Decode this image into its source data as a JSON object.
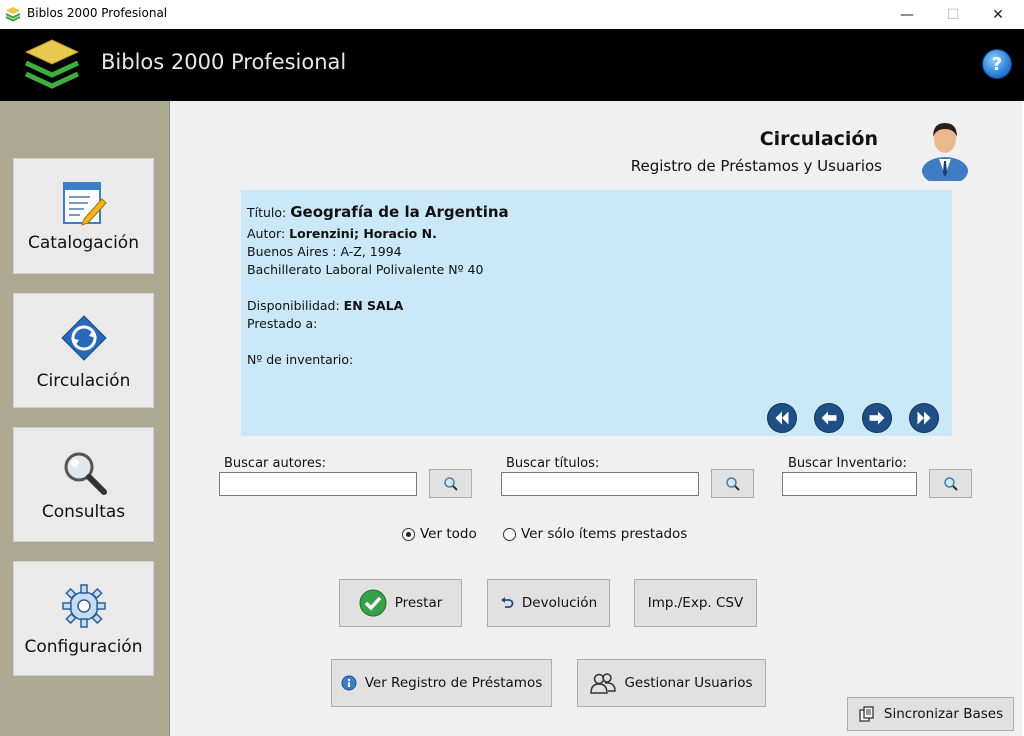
{
  "window": {
    "title": "Biblos 2000 Profesional",
    "minimize": "—",
    "maximize": "☐",
    "close": "✕"
  },
  "header": {
    "app_title": "Biblos 2000 Profesional",
    "help_label": "?"
  },
  "sidebar": {
    "items": [
      {
        "label": "Catalogación",
        "icon": "catalog-icon"
      },
      {
        "label": "Circulación",
        "icon": "circulation-icon"
      },
      {
        "label": "Consultas",
        "icon": "magnifier-icon"
      },
      {
        "label": "Configuración",
        "icon": "gear-icon"
      }
    ]
  },
  "section": {
    "title": "Circulación",
    "subtitle": "Registro de Préstamos y Usuarios"
  },
  "record": {
    "title_label": "Título:",
    "title_value": "Geografía de la Argentina",
    "author_label": "Autor:",
    "author_value": "Lorenzini; Horacio N.",
    "publisher": "Buenos Aires : A-Z, 1994",
    "library": "Bachillerato Laboral Polivalente Nº 40",
    "availability_label": "Disponibilidad:",
    "availability_value": "EN SALA",
    "lent_to_label": "Prestado a:",
    "inventory_label": "Nº de inventario:"
  },
  "search": {
    "authors_label": "Buscar autores:",
    "titles_label": "Buscar títulos:",
    "inventory_label": "Buscar Inventario:",
    "authors_value": "",
    "titles_value": "",
    "inventory_value": ""
  },
  "filter": {
    "all_label": "Ver todo",
    "lent_only_label": "Ver sólo ítems prestados",
    "selected": "all"
  },
  "actions": {
    "lend": "Prestar",
    "return": "Devolución",
    "csv": "Imp./Exp. CSV",
    "loan_log": "Ver Registro de Préstamos",
    "manage_users": "Gestionar Usuarios",
    "sync": "Sincronizar Bases"
  }
}
